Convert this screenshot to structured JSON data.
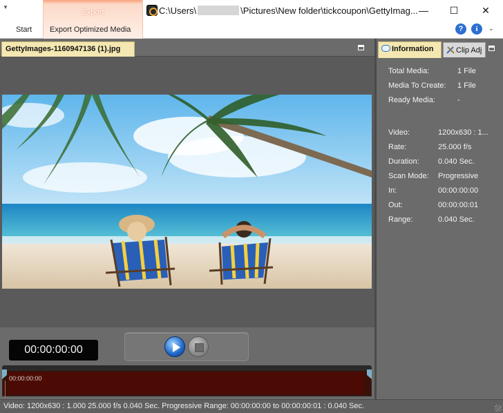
{
  "ribbon": {
    "context_tab": "Export",
    "tabs": [
      {
        "label": "Start"
      },
      {
        "label": "Export Optimized Media"
      }
    ]
  },
  "title_bar": {
    "path_prefix": "C:\\Users\\",
    "path_suffix": "\\Pictures\\New folder\\tickcoupon\\GettyImag...",
    "minimize": "—",
    "maximize": "☐",
    "close": "✕"
  },
  "help_icons": {
    "help": "?",
    "info": "i",
    "collapse": "⌄"
  },
  "document": {
    "tab_label": "GettyImages-1160947136  (1).jpg"
  },
  "player": {
    "timecode": "00:00:00:00",
    "timeline_label": "00:00:00:00"
  },
  "right_panel": {
    "tabs": {
      "information": "Information",
      "clip_adj": "Clip Adj"
    },
    "media_info": [
      {
        "label": "Total Media:",
        "value": "1 File"
      },
      {
        "label": "Media To Create:",
        "value": "1 File"
      },
      {
        "label": "Ready Media:",
        "value": "-"
      }
    ],
    "clip_info": [
      {
        "label": "Video:",
        "value": "1200x630  : 1..."
      },
      {
        "label": "Rate:",
        "value": "25.000 f/s"
      },
      {
        "label": "Duration:",
        "value": "0.040 Sec."
      },
      {
        "label": "Scan Mode:",
        "value": "Progressive"
      },
      {
        "label": "In:",
        "value": "00:00:00:00"
      },
      {
        "label": "Out:",
        "value": "00:00:00:01"
      },
      {
        "label": "Range:",
        "value": "0.040 Sec."
      }
    ]
  },
  "status_bar": {
    "text": "Video: 1200x630 : 1.000  25.000 f/s  0.040 Sec.  Progressive  Range: 00:00:00:00 to 00:00:00:01 : 0.040 Sec."
  },
  "colors": {
    "ribbon_accent": "#f9a27c",
    "active_tab": "#f4e7b1",
    "panel_bg": "#6b6b6b",
    "timeline": "#4b0b04"
  }
}
